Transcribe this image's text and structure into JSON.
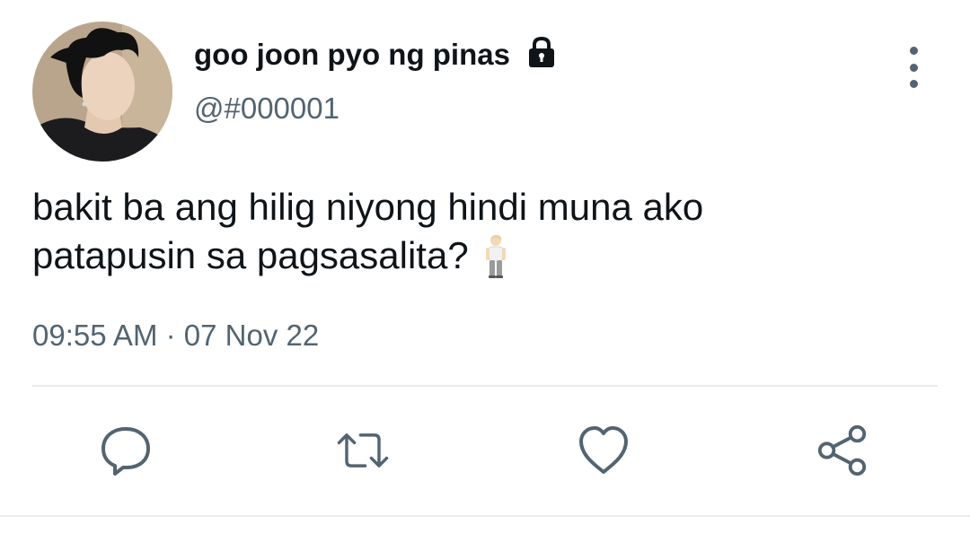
{
  "tweet": {
    "display_name": "goo joon pyo ng pinas",
    "handle": "@#000001",
    "text_line_1": "bakit ba ang hilig niyong hindi muna ako",
    "text_line_2": "patapusin sa pagsasalita?",
    "emoji": "man-standing-emoji",
    "timestamp": "09:55 AM · 07 Nov 22",
    "protected_icon": "lock-icon"
  },
  "actions": {
    "reply_icon": "reply-icon",
    "retweet_icon": "retweet-icon",
    "like_icon": "heart-icon",
    "share_icon": "share-icon"
  },
  "menu": {
    "icon": "more-vertical-icon"
  },
  "colors": {
    "text": "#0f1419",
    "secondary": "#536471",
    "divider": "#e6ecf0"
  }
}
